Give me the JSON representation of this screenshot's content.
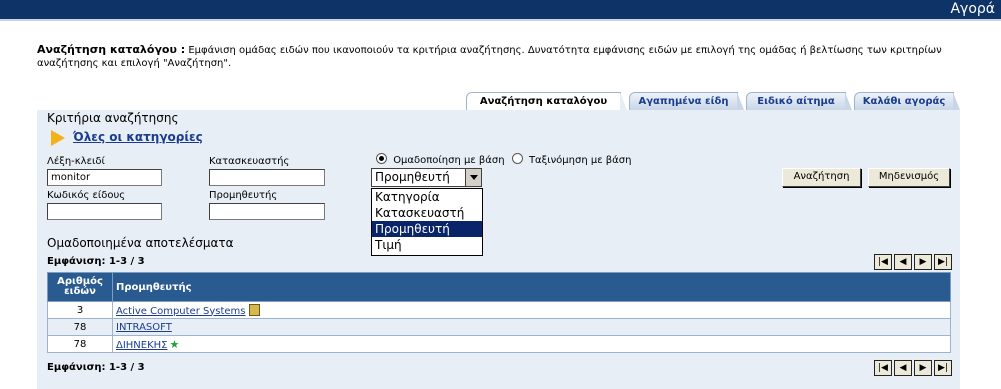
{
  "header": {
    "title": "Αγορά"
  },
  "intro": {
    "heading": "Αναζήτηση καταλόγου :",
    "text": " Εμφάνιση ομάδας ειδών που ικανοποιούν τα κριτήρια αναζήτησης. Δυνατότητα εμφάνισης ειδών με επιλογή της ομάδας ή βελτίωσης των κριτηρίων αναζήτησης και επιλογή \"Αναζήτηση\"."
  },
  "tabs": [
    {
      "label": "Αναζήτηση καταλόγου",
      "active": true
    },
    {
      "label": "Αγαπημένα είδη"
    },
    {
      "label": "Ειδικό αίτημα"
    },
    {
      "label": "Καλάθι αγοράς"
    }
  ],
  "criteria": {
    "title": "Κριτήρια αναζήτησης",
    "all_categories": "Όλες οι κατηγορίες",
    "keyword_label": "Λέξη-κλειδί",
    "keyword_value": "monitor",
    "manufacturer_label": "Κατασκευαστής",
    "manufacturer_value": "",
    "item_code_label": "Κωδικός είδους",
    "item_code_value": "",
    "supplier_label": "Προμηθευτής",
    "supplier_value": "",
    "group_by_label": "Ομαδοποίηση με βάση",
    "sort_by_label": "Ταξινόμηση με βάση",
    "group_by_selected": "Προμηθευτή",
    "group_by_options": [
      "Κατηγορία",
      "Κατασκευαστή",
      "Προμηθευτή",
      "Τιμή"
    ],
    "search_button": "Αναζήτηση",
    "reset_button": "Μηδενισμός"
  },
  "results": {
    "title": "Ομαδοποιημένα αποτελέσματα",
    "showing": "Εμφάνιση: 1-3 / 3",
    "col_count": "Αριθμός ειδών",
    "col_supplier": "Προμηθευτής",
    "rows": [
      {
        "count": "3",
        "supplier": "Active Computer Systems",
        "icon": "shop-icon"
      },
      {
        "count": "78",
        "supplier": "INTRASOFT"
      },
      {
        "count": "78",
        "supplier": "ΔΙΗΝΕΚΗΣ",
        "icon": "star-icon"
      }
    ]
  },
  "pager_icons": [
    "first-page-icon",
    "prev-page-icon",
    "next-page-icon",
    "last-page-icon"
  ],
  "colors": {
    "header_bg": "#0e3367",
    "table_header": "#2a5b90",
    "panel_bg": "#e8eef5",
    "link": "#1a3c8e"
  }
}
